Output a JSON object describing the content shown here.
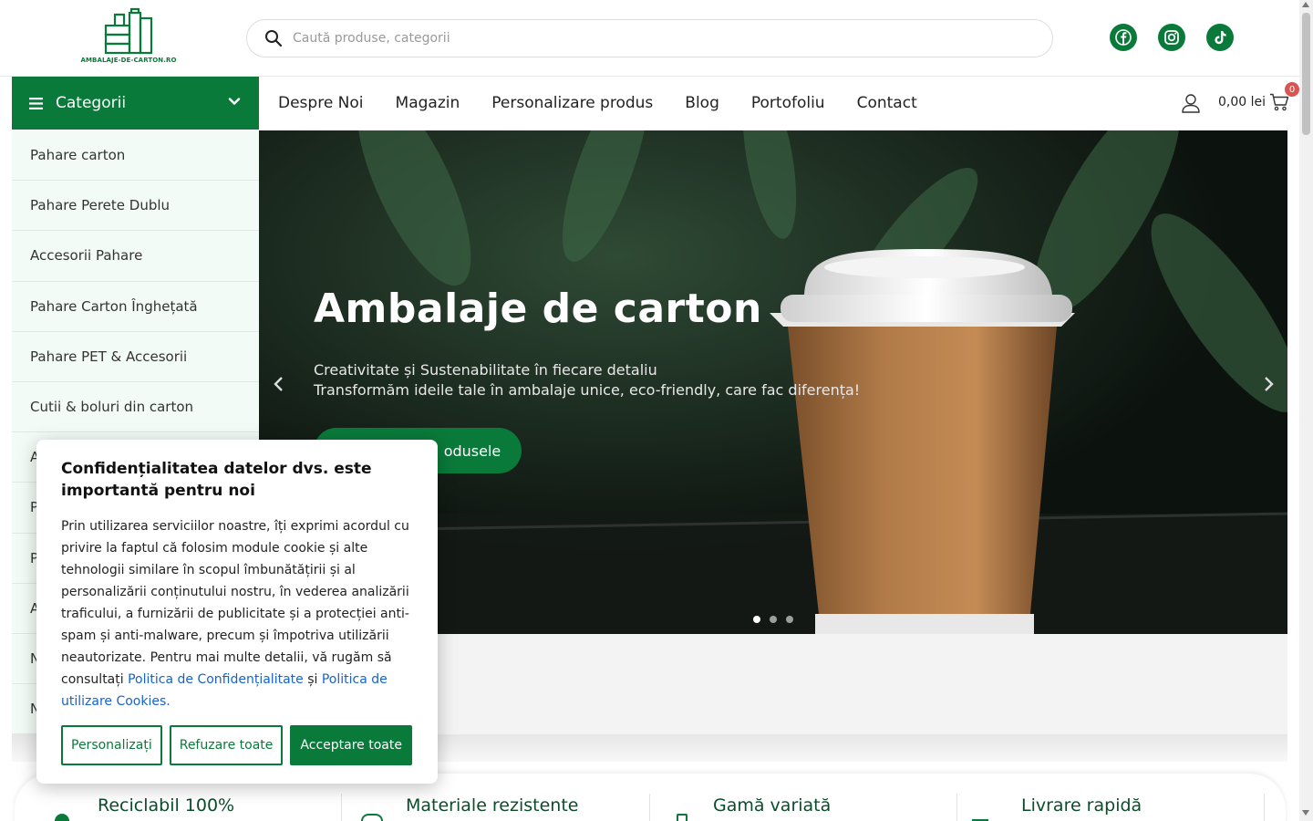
{
  "brand": {
    "logo_text": "AMBALAJE-DE-CARTON.RO",
    "accent_color": "#0a7a3a"
  },
  "search": {
    "placeholder": "Caută produse, categorii"
  },
  "socials": [
    {
      "icon": "facebook-icon"
    },
    {
      "icon": "instagram-icon"
    },
    {
      "icon": "tiktok-icon"
    }
  ],
  "nav": {
    "categories_label": "Categorii",
    "menu": [
      "Despre Noi",
      "Magazin",
      "Personalizare produs",
      "Blog",
      "Portofoliu",
      "Contact"
    ],
    "cart_total": "0,00 lei",
    "cart_count": "0"
  },
  "sidebar": {
    "items": [
      "Pahare carton",
      "Pahare Perete Dublu",
      "Accesorii Pahare",
      "Pahare Carton Înghețată",
      "Pahare PET & Accesorii",
      "Cutii & boluri din carton",
      "A",
      "P",
      "P",
      "A",
      "N",
      "N"
    ]
  },
  "hero": {
    "title": "Ambalaje de carton",
    "subtitle_line1": "Creativitate și Sustenabilitate în fiecare detaliu",
    "subtitle_line2": "Transformăm ideile tale în ambalaje unice, eco-friendly, care fac diferența!",
    "button_label": "odusele"
  },
  "features": [
    "Reciclabil 100%",
    "Materiale rezistente",
    "Gamă variată",
    "Livrare rapidă"
  ],
  "cookie": {
    "title": "Confidențialitatea datelor dvs. este importantă pentru noi",
    "body": "Prin utilizarea serviciilor noastre, îți exprimi acordul cu privire la faptul că folosim module cookie și alte tehnologii similare în scopul îmbunătățirii și al personalizării conținutului nostru, în vederea analizării traficului, a furnizării de publicitate și a protecției anti-spam și anti-malware, precum și împotriva utilizării neautorizate. Pentru mai multe detalii, vă rugăm să consultați",
    "link1": "Politica de Confidențialitate",
    "and": "și",
    "link2": "Politica de utilizare Cookies.",
    "btn_customize": "Personalizați",
    "btn_reject": "Refuzare toate",
    "btn_accept": "Acceptare toate"
  }
}
